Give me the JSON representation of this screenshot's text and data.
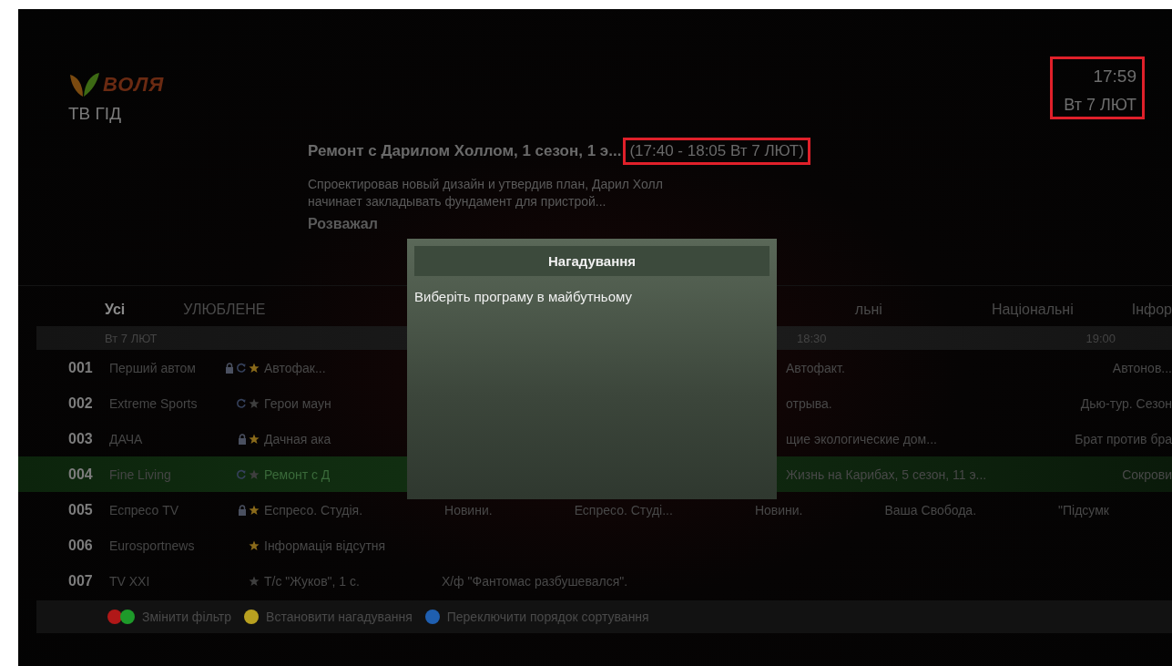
{
  "header": {
    "logo_text": "ВОЛЯ",
    "section_title": "ТВ ГІД",
    "clock": {
      "time": "17:59",
      "date": "Вт 7 ЛЮТ"
    }
  },
  "program_info": {
    "title": "Ремонт с Дарилом Холлом, 1 сезон, 1 э...",
    "time_range": "(17:40 - 18:05 Вт 7 ЛЮТ)",
    "description": "Спроектировав новый дизайн и утвердив план, Дарил Холл начинает закладывать фундамент для пристрой...",
    "genre": "Розважал"
  },
  "filter_tabs": [
    {
      "label": "Усі",
      "selected": true
    },
    {
      "label": "УЛЮБЛЕНЕ",
      "selected": false
    },
    {
      "label": "льні",
      "selected": false
    },
    {
      "label": "Національні",
      "selected": false
    },
    {
      "label": "Інфор",
      "selected": false
    }
  ],
  "timeline": {
    "date": "Вт 7 ЛЮТ",
    "times": [
      "18:30",
      "19:00"
    ]
  },
  "channels": [
    {
      "number": "001",
      "name": "Перший автом",
      "locked": true,
      "recurring": true,
      "favorite": true,
      "selected": false,
      "programs_left": [
        "Автофак..."
      ],
      "programs_right": [
        "Автофакт.",
        "Автонов..."
      ]
    },
    {
      "number": "002",
      "name": "Extreme Sports",
      "locked": false,
      "recurring": true,
      "favorite": false,
      "selected": false,
      "programs_left": [
        "Герои маун"
      ],
      "programs_right": [
        "отрыва.",
        "Дью-тур. Сезон"
      ]
    },
    {
      "number": "003",
      "name": "ДАЧА",
      "locked": true,
      "recurring": false,
      "favorite": true,
      "selected": false,
      "programs_left": [
        "Дачная ака"
      ],
      "programs_right": [
        "щие экологические дом...",
        "Брат против бра"
      ]
    },
    {
      "number": "004",
      "name": "Fine Living",
      "locked": false,
      "recurring": true,
      "favorite": false,
      "selected": true,
      "programs_left": [
        "Ремонт с Д"
      ],
      "programs_right": [
        "Жизнь на Карибах, 5 сезон, 11 э...",
        "Сокрови"
      ]
    },
    {
      "number": "005",
      "name": "Еспресо TV",
      "locked": true,
      "recurring": false,
      "favorite": true,
      "selected": false,
      "programs": [
        "Еспресо. Студія.",
        "Новини.",
        "Еспресо. Студі...",
        "Новини.",
        "Ваша Свобода.",
        "\"Підсумк"
      ]
    },
    {
      "number": "006",
      "name": "Eurosportnews",
      "locked": false,
      "recurring": false,
      "favorite": true,
      "selected": false,
      "programs": [
        "Інформація відсутня"
      ]
    },
    {
      "number": "007",
      "name": "TV XXI",
      "locked": false,
      "recurring": false,
      "favorite": false,
      "selected": false,
      "programs": [
        "Т/с \"Жуков\", 1 с.",
        "Х/ф \"Фантомас разбушевался\"."
      ]
    }
  ],
  "footer_hints": [
    {
      "dots": [
        {
          "color": "#b01818"
        },
        {
          "color": "#1e9a2a"
        }
      ],
      "label": "Змінити фільтр"
    },
    {
      "dots": [
        {
          "color": "#b8a020"
        }
      ],
      "label": "Встановити нагадування"
    },
    {
      "dots": [
        {
          "color": "#1f5fb0"
        }
      ],
      "label": "Переключити порядок сортування"
    }
  ],
  "dialog": {
    "title": "Нагадування",
    "message": "Виберіть програму в майбутньому"
  }
}
